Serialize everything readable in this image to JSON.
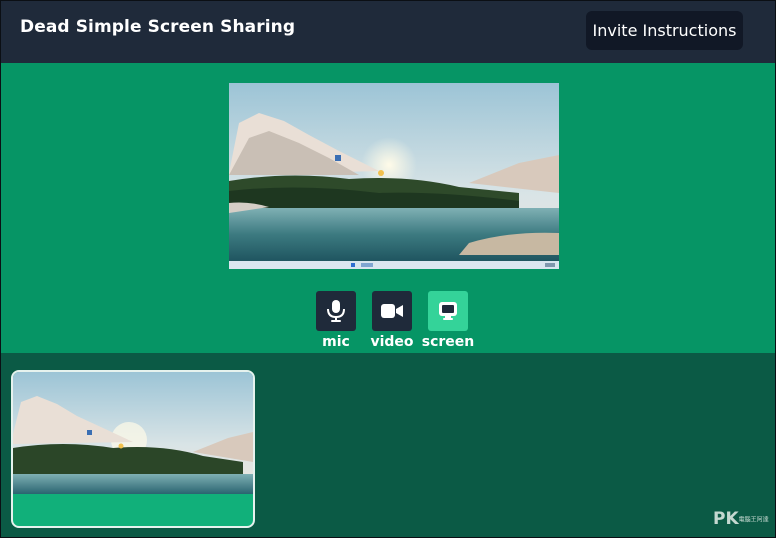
{
  "app": {
    "title": "Dead Simple Screen Sharing",
    "invite_label": "Invite Instructions"
  },
  "controls": [
    {
      "label": "mic",
      "icon": "microphone-icon",
      "active": false
    },
    {
      "label": "video",
      "icon": "video-camera-icon",
      "active": false
    },
    {
      "label": "screen",
      "icon": "screen-share-icon",
      "active": true
    }
  ],
  "main_stream": {
    "content": "shared-desktop-landscape-wallpaper"
  },
  "thumbnail": {
    "content": "shared-desktop-landscape-wallpaper"
  },
  "watermark": {
    "logo": "PK",
    "small": "電腦王阿達"
  },
  "colors": {
    "topbar": "#1f2a3a",
    "main_green": "#069565",
    "dark_green": "#0b5a45",
    "active_button": "#34d399",
    "button_dark": "#1f2a3a"
  }
}
